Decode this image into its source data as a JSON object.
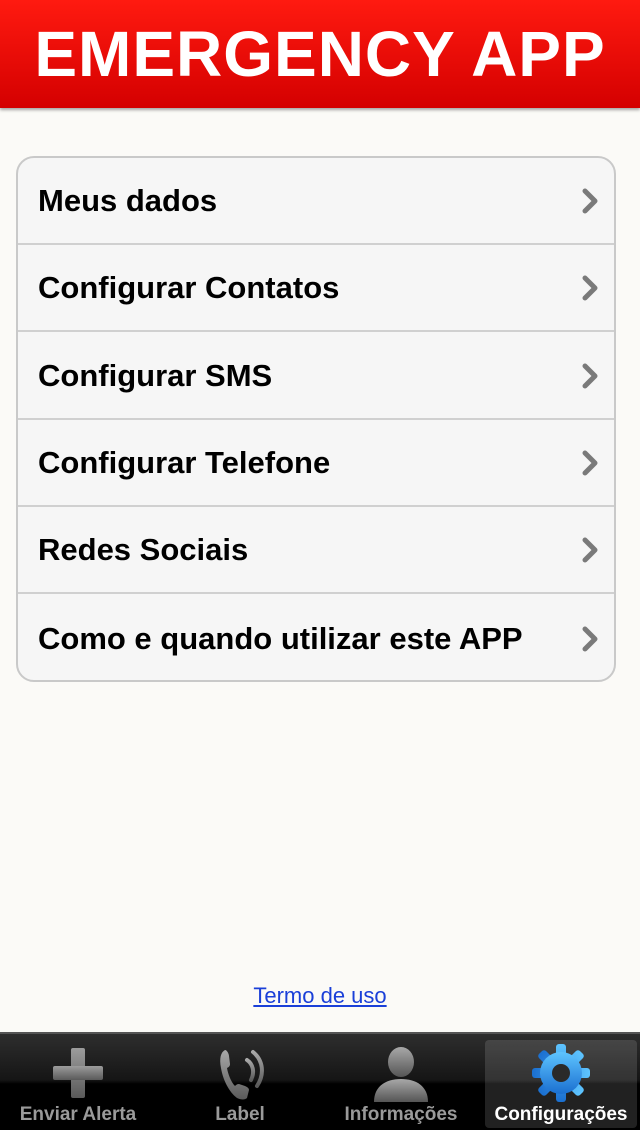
{
  "header": {
    "title": "EMERGENCY APP"
  },
  "menu": {
    "items": [
      {
        "label": "Meus dados"
      },
      {
        "label": "Configurar Contatos"
      },
      {
        "label": "Configurar SMS"
      },
      {
        "label": "Configurar Telefone"
      },
      {
        "label": "Redes Sociais"
      },
      {
        "label": "Como e quando utilizar este APP"
      }
    ]
  },
  "footer": {
    "terms_link": "Termo de uso"
  },
  "tabbar": {
    "tabs": [
      {
        "label": "Enviar Alerta",
        "icon": "plus-icon"
      },
      {
        "label": "Label",
        "icon": "phone-icon"
      },
      {
        "label": "Informações",
        "icon": "person-icon"
      },
      {
        "label": "Configurações",
        "icon": "gear-icon",
        "selected": true
      }
    ]
  },
  "colors": {
    "header": "#e60000",
    "link": "#1a3fd8",
    "tab_active_icon": "#2b8fe0"
  }
}
